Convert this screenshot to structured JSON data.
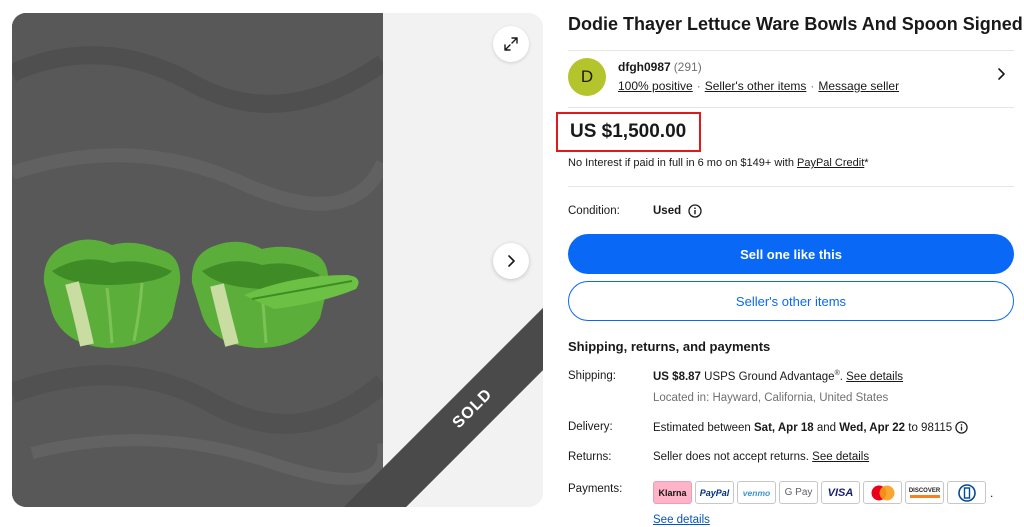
{
  "listing": {
    "title": "Dodie Thayer Lettuce Ware Bowls And Spoon Signed",
    "sold_label": "SOLD"
  },
  "seller": {
    "avatar_letter": "D",
    "name": "dfgh0987",
    "feedback_count": "(291)",
    "positive": "100% positive",
    "other_items": "Seller's other items",
    "message": "Message seller"
  },
  "price": {
    "amount": "US $1,500.00",
    "credit_prefix": "No Interest if paid in full in 6 mo on $149+ with ",
    "credit_link": "PayPal Credit",
    "credit_suffix": "*"
  },
  "condition": {
    "label": "Condition:",
    "value": "Used"
  },
  "buttons": {
    "sell_one": "Sell one like this",
    "other_items": "Seller's other items"
  },
  "shipping": {
    "heading": "Shipping, returns, and payments",
    "shipping_label": "Shipping:",
    "shipping_cost": "US $8.87",
    "shipping_service": " USPS Ground Advantage",
    "shipping_reg": "®",
    "shipping_sep": ". ",
    "see_details": "See details",
    "located": "Located in: Hayward, California, United States",
    "delivery_label": "Delivery:",
    "delivery_prefix": "Estimated between ",
    "delivery_start": "Sat, Apr 18",
    "delivery_and": " and ",
    "delivery_end": "Wed, Apr 22",
    "delivery_suffix": " to 98115",
    "returns_label": "Returns:",
    "returns_text": "Seller does not accept returns. ",
    "returns_link": "See details",
    "payments_label": "Payments:",
    "payments_link": "See details"
  },
  "payments": {
    "klarna": "Klarna",
    "paypal": "PayPal",
    "venmo": "venmo",
    "gpay": "G Pay",
    "visa": "VISA",
    "discover": "DISCOVER",
    "trailing": "."
  },
  "colors": {
    "accent": "#0968f6",
    "price_box": "#e0191b",
    "avatar": "#b4c42c",
    "sold_band": "#4a4a4a"
  },
  "icons": [
    "expand-icon",
    "chevron-right-icon",
    "info-icon",
    "mastercard-icon",
    "diners-club-icon"
  ]
}
